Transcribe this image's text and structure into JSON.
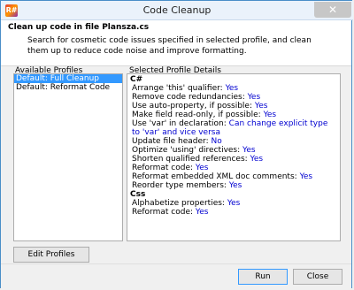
{
  "window": {
    "title": "Code Cleanup",
    "app_icon": "R#",
    "close_glyph": "✕"
  },
  "header": {
    "title": "Clean up code in file Plansza.cs",
    "description": "Search for cosmetic code issues specified in selected profile, and clean them up to reduce code noise and improve formatting."
  },
  "profiles": {
    "label": "Available Profiles",
    "items": [
      {
        "label": "Default: Full Cleanup"
      },
      {
        "label": "Default: Reformat Code"
      }
    ],
    "edit_button": "Edit Profiles"
  },
  "details": {
    "label": "Selected Profile Details",
    "groups": [
      {
        "title": "C#",
        "rows": [
          {
            "label": "Arrange 'this' qualifier:",
            "value": "Yes"
          },
          {
            "label": "Remove code redundancies:",
            "value": "Yes"
          },
          {
            "label": "Use auto-property, if possible:",
            "value": "Yes"
          },
          {
            "label": "Make field read-only, if possible:",
            "value": "Yes"
          },
          {
            "label": "Use 'var' in declaration:",
            "value": "Can change explicit type to 'var' and vice versa"
          },
          {
            "label": "Update file header:",
            "value": "No"
          },
          {
            "label": "Optimize 'using' directives:",
            "value": "Yes"
          },
          {
            "label": "Shorten qualified references:",
            "value": "Yes"
          },
          {
            "label": "Reformat code:",
            "value": "Yes"
          },
          {
            "label": "Reformat embedded XML doc comments:",
            "value": "Yes"
          },
          {
            "label": "Reorder type members:",
            "value": "Yes"
          }
        ]
      },
      {
        "title": "Css",
        "rows": [
          {
            "label": "Alphabetize properties:",
            "value": "Yes"
          },
          {
            "label": "Reformat code:",
            "value": "Yes"
          }
        ]
      }
    ]
  },
  "footer": {
    "run": "Run",
    "close": "Close"
  },
  "colors": {
    "accent": "#3399ff",
    "value_blue": "#0000d0",
    "border_blue": "#4a8ec8"
  }
}
